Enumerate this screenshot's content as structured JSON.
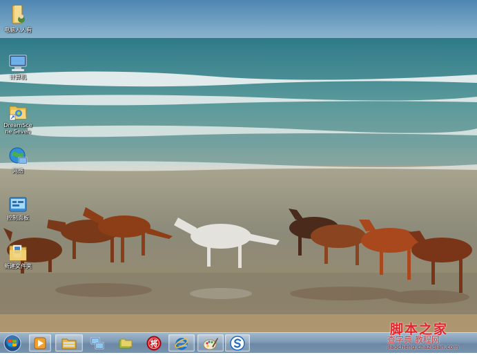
{
  "desktop": {
    "icons": [
      {
        "label": "电脑人人有",
        "icon": "user-folder-icon"
      },
      {
        "label": "计算机",
        "icon": "computer-icon"
      },
      {
        "label": "DreamScene Seven",
        "icon": "shortcut-folder-icon"
      },
      {
        "label": "网络",
        "icon": "network-icon"
      },
      {
        "label": "控制面板",
        "icon": "control-panel-icon"
      },
      {
        "label": "新建文件夹",
        "icon": "folder-icon"
      }
    ]
  },
  "taskbar": {
    "start_icon": "windows-orb-icon",
    "buttons": [
      {
        "icon": "media-player-icon"
      },
      {
        "icon": "file-explorer-icon"
      },
      {
        "icon": "network-computer-icon"
      },
      {
        "icon": "folders-icon"
      },
      {
        "icon": "chess-app-icon",
        "glyph": "将"
      },
      {
        "icon": "internet-explorer-icon"
      },
      {
        "icon": "paint-icon"
      },
      {
        "icon": "sogou-icon"
      }
    ]
  },
  "watermark": {
    "title": "脚本之家",
    "subtitle": "查字典 教程网",
    "url": "jiaocheng.chazidian.com"
  },
  "colors": {
    "sky": "#5f93b8",
    "sea": "#3f8a92",
    "sand": "#9b8d72",
    "taskbar": "#7e9ab5",
    "watermark": "#e8222a"
  }
}
